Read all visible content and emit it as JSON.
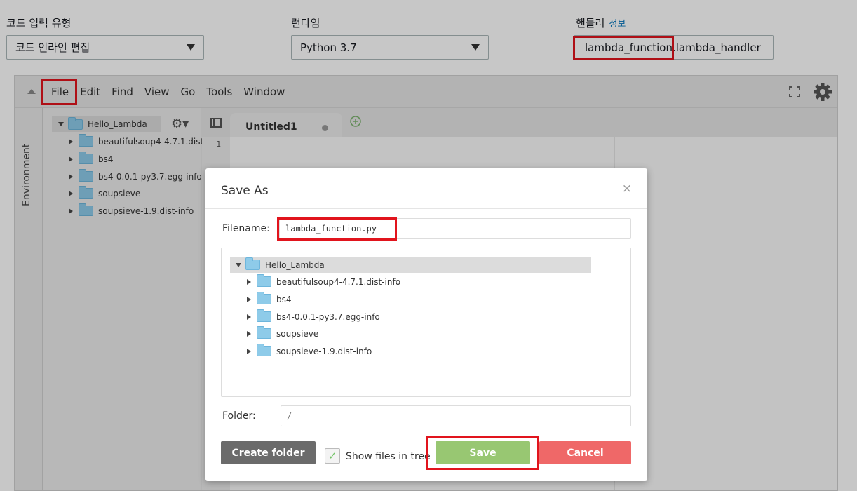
{
  "config": {
    "code_entry_label": "코드 입력 유형",
    "code_entry_value": "코드 인라인 편집",
    "runtime_label": "런타임",
    "runtime_value": "Python 3.7",
    "handler_label": "핸들러",
    "handler_info": "정보",
    "handler_value": "lambda_function.lambda_handler"
  },
  "ide": {
    "menu": [
      "File",
      "Edit",
      "Find",
      "View",
      "Go",
      "Tools",
      "Window"
    ],
    "env_tab": "Environment",
    "tree": {
      "root": "Hello_Lambda",
      "children": [
        "beautifulsoup4-4.7.1.dist",
        "bs4",
        "bs4-0.0.1-py3.7.egg-info",
        "soupsieve",
        "soupsieve-1.9.dist-info"
      ]
    },
    "tab_title": "Untitled1",
    "line_number": "1"
  },
  "dialog": {
    "title": "Save As",
    "close": "×",
    "filename_label": "Filename:",
    "filename_value": "lambda_function.py",
    "tree_root": "Hello_Lambda",
    "tree_children": [
      "beautifulsoup4-4.7.1.dist-info",
      "bs4",
      "bs4-0.0.1-py3.7.egg-info",
      "soupsieve",
      "soupsieve-1.9.dist-info"
    ],
    "folder_label": "Folder:",
    "folder_value": "/",
    "create_folder": "Create folder",
    "show_files": "Show files in tree",
    "save": "Save",
    "cancel": "Cancel"
  },
  "colors": {
    "highlight": "#e1141d",
    "save_button": "#98c772",
    "cancel_button": "#ef6868",
    "create_folder_button": "#6b6b6b",
    "link": "#0073bb"
  }
}
